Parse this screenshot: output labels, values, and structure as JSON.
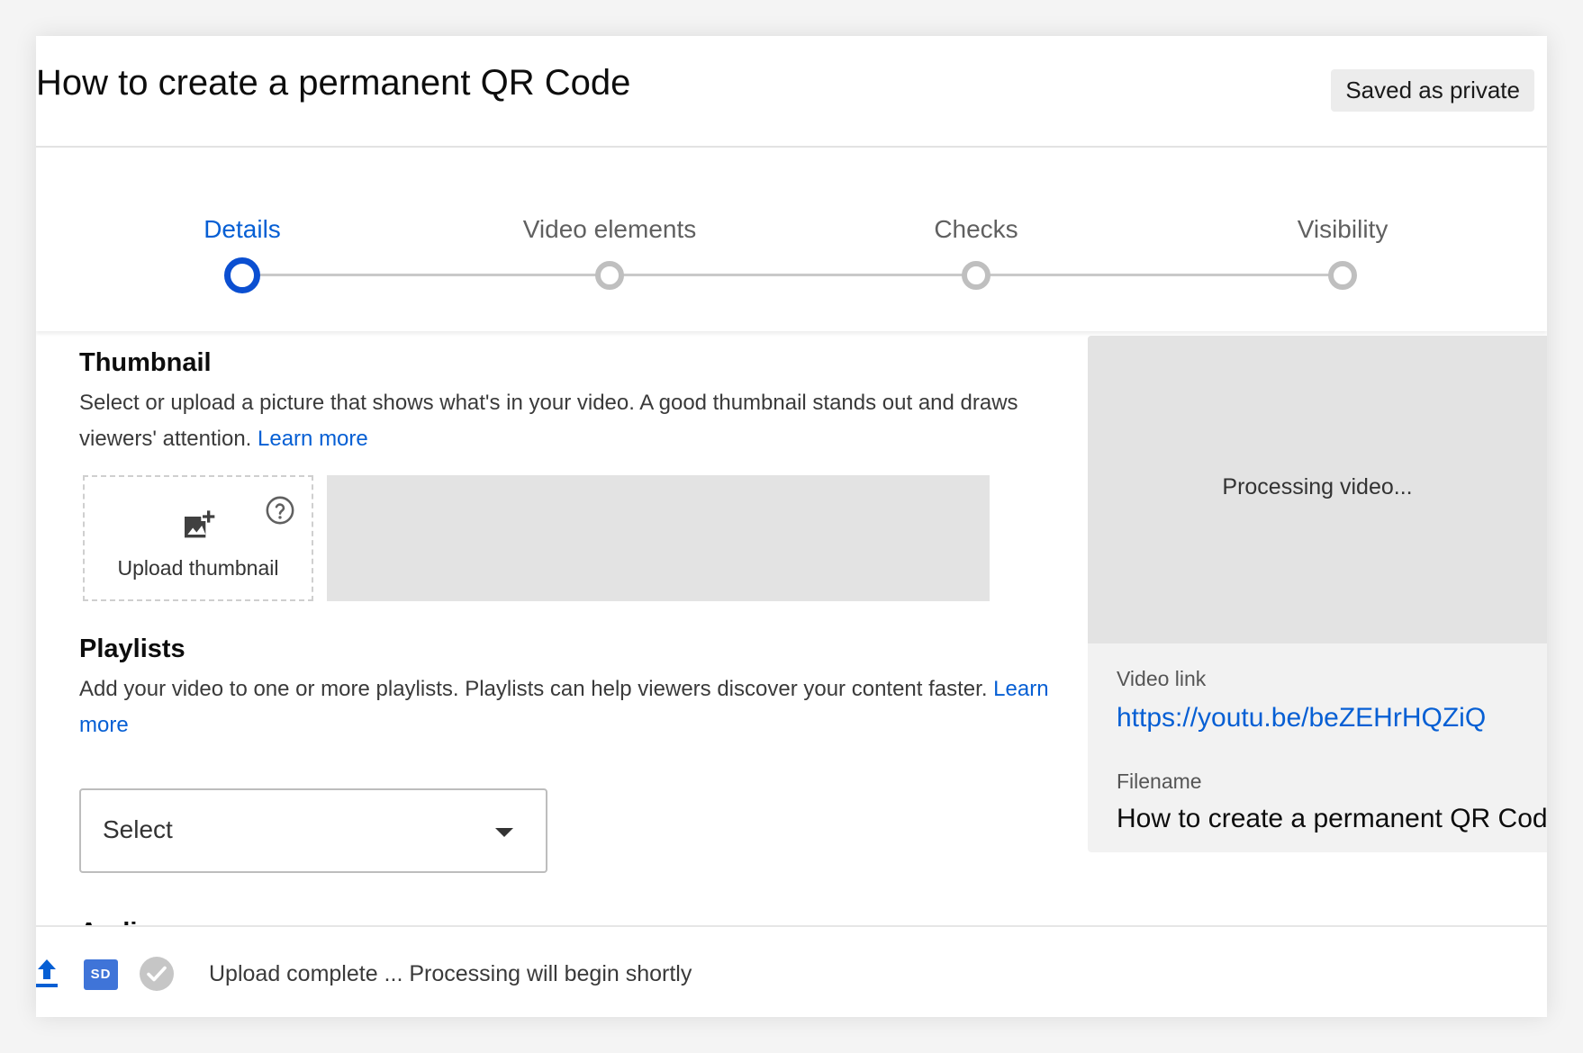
{
  "header": {
    "title": "How to create a permanent QR Code",
    "status_badge": "Saved as private"
  },
  "stepper": {
    "active_step": "Details",
    "steps": [
      {
        "label": "Details",
        "state": "active"
      },
      {
        "label": "Video elements",
        "state": "pending"
      },
      {
        "label": "Checks",
        "state": "pending"
      },
      {
        "label": "Visibility",
        "state": "pending"
      }
    ],
    "active_color": "#065fd4"
  },
  "thumbnail": {
    "title": "Thumbnail",
    "description": "Select or upload a picture that shows what's in your video. A good thumbnail stands out and draws viewers' attention.",
    "learn_more": "Learn more",
    "upload_label": "Upload thumbnail",
    "upload_icon": "add-photo-icon",
    "help_icon": "help-circle-icon",
    "placeholder_slots": 3
  },
  "playlists": {
    "title": "Playlists",
    "description": "Add your video to one or more playlists. Playlists can help viewers discover your content faster.",
    "learn_more": "Learn more",
    "select_value": "Select"
  },
  "audience": {
    "title": "Audience"
  },
  "side_panel": {
    "preview_text": "Processing video...",
    "video_link_label": "Video link",
    "video_link": "https://youtu.be/beZEHrHQZiQ",
    "filename_label": "Filename",
    "filename": "How to create a permanent QR Code"
  },
  "footer": {
    "upload_icon": "upload-icon",
    "quality_badge": "SD",
    "check_icon": "check-circle-icon",
    "status": "Upload complete ... Processing will begin shortly"
  }
}
